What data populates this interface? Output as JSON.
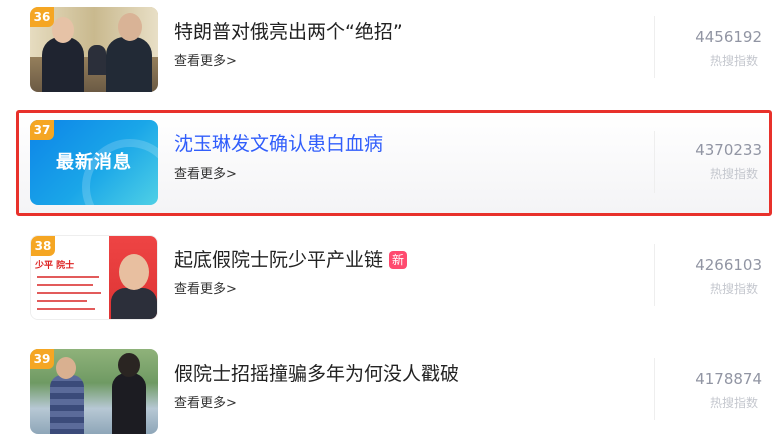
{
  "items": [
    {
      "rank": "36",
      "title": "特朗普对俄亮出两个“绝招”",
      "more": "查看更多>",
      "score": "4456192",
      "score_label": "热搜指数",
      "badge": ""
    },
    {
      "rank": "37",
      "title": "沈玉琳发文确认患白血病",
      "more": "查看更多>",
      "score": "4370233",
      "score_label": "热搜指数",
      "badge": "",
      "thumb_text": "最新消息"
    },
    {
      "rank": "38",
      "title": "起底假院士阮少平产业链",
      "more": "查看更多>",
      "score": "4266103",
      "score_label": "热搜指数",
      "badge": "新",
      "thumb_text": "少平 院士"
    },
    {
      "rank": "39",
      "title": "假院士招摇撞骗多年为何没人戳破",
      "more": "查看更多>",
      "score": "4178874",
      "score_label": "热搜指数",
      "badge": ""
    }
  ],
  "colors": {
    "rank_badge": "#f5a623",
    "highlight_border": "#e8312b",
    "link_title": "#315efb",
    "new_badge": "#ff4a6f"
  }
}
